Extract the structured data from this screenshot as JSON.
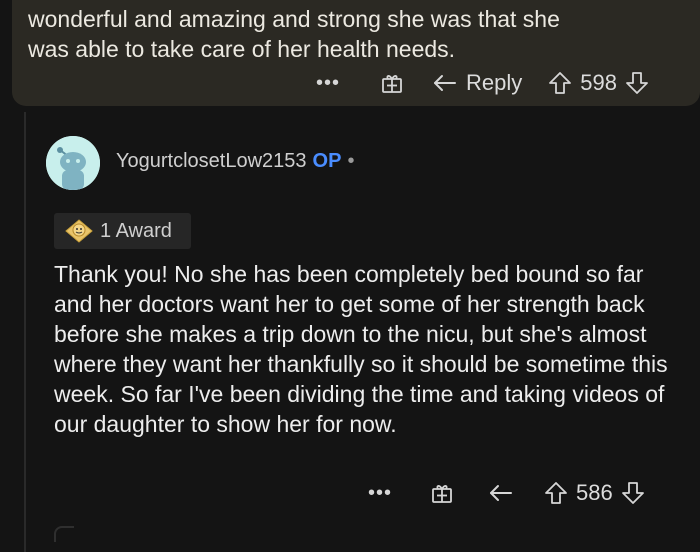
{
  "parent_comment": {
    "text_lines": [
      "wonderful and amazing and strong she was that she",
      "was able to take care of her health needs."
    ],
    "actions": {
      "more": "•••",
      "reply_label": "Reply",
      "score": "598"
    }
  },
  "reply_comment": {
    "username": "YogurtclosetLow2153",
    "op_badge": "OP",
    "separator": "•",
    "award_label": "1 Award",
    "text": "Thank you! No she has been completely bed bound so far and her doctors want her to get some of her strength back before she makes a trip down to the nicu, but she's almost where they want her thankfully so it should be sometime this week. So far I've been dividing the time and taking videos of our daughter to show her for now.",
    "actions": {
      "more": "•••",
      "score": "586"
    }
  },
  "colors": {
    "background": "#141414",
    "parent_card": "#2b2923",
    "op_blue": "#4a8dff",
    "avatar_bg": "#c8efec"
  }
}
